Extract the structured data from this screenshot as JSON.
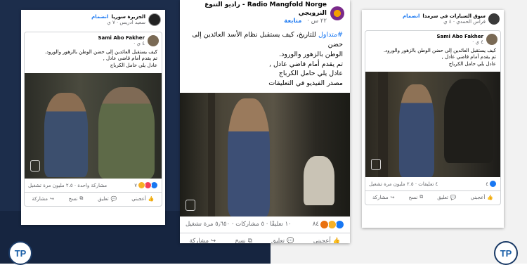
{
  "colors": {
    "left_bg": "#1c2d4b",
    "right_bg": "#f2f2f2",
    "link": "#1877f2",
    "muted": "#65676b"
  },
  "cards": [
    {
      "page_name": "الجزيرة سوريا",
      "join_label": "انضمام",
      "meta": "سعيد ادريس · ٧ ي",
      "shared_author": "Sami Abo Fakher",
      "shared_time": "٤ ي ·",
      "lines": [
        "كيف يستقبل العائدين إلى حضن الوطن بالزهور والورود.",
        "تم يقدم أمام قاضي عادل ,",
        "عادل يلي حامل الكرباج"
      ],
      "reaction_count": "٧",
      "stats_text": "مشاركة واحدة · ٢.٥ مليون مرة تشغيل",
      "actions": {
        "like": "أعجبني",
        "comment": "تعليق",
        "copy": "نسخ",
        "share": "مشاركة"
      }
    },
    {
      "page_name": "Radio Mangfold Norge - راديو التنوع النرويجي",
      "follow_label": "متابعة",
      "meta": "٢٢ س ·",
      "hashtag": "#متداول",
      "lines": [
        "للتاريخ، كيف يستقبل نظام الأسد العائدين إلى حضن",
        "الوطن بالزهور والورود.",
        "تم يقدم أمام قاضي عادل ,",
        "عادل يلي حامل الكرباج",
        "مصدر الفيديو في التعليقات"
      ],
      "reaction_count": "٨٤",
      "stats_text": "١٠ تعليقًا · ٥ مشاركات · ٥٫٦٥٠ مرة تشغيل",
      "actions": {
        "like": "أعجبني",
        "comment": "تعليق",
        "copy": "نسخ",
        "share": "مشاركة"
      }
    },
    {
      "page_name": "سوق السيارات في سرمدا",
      "join_label": "انضمام",
      "meta": "فراس الحمدي · ٤ ي",
      "shared_author": "Sami Abo Fakher",
      "shared_time": "٤ ي ·",
      "lines": [
        "كيف يستقبل العائدين إلى حضن الوطن بالزهور والورود.",
        "تم يقدم أمام قاضي عادل ,",
        "عادل يلي حامل الكرباج"
      ],
      "reaction_count": "٤",
      "stats_text": "٤ تعليقات · ٢.٥ مليون مرة تشغيل",
      "actions": {
        "like": "أعجبني",
        "comment": "تعليق",
        "copy": "نسخ",
        "share": "مشاركة"
      }
    }
  ],
  "brand": {
    "logo_text": "TP"
  }
}
